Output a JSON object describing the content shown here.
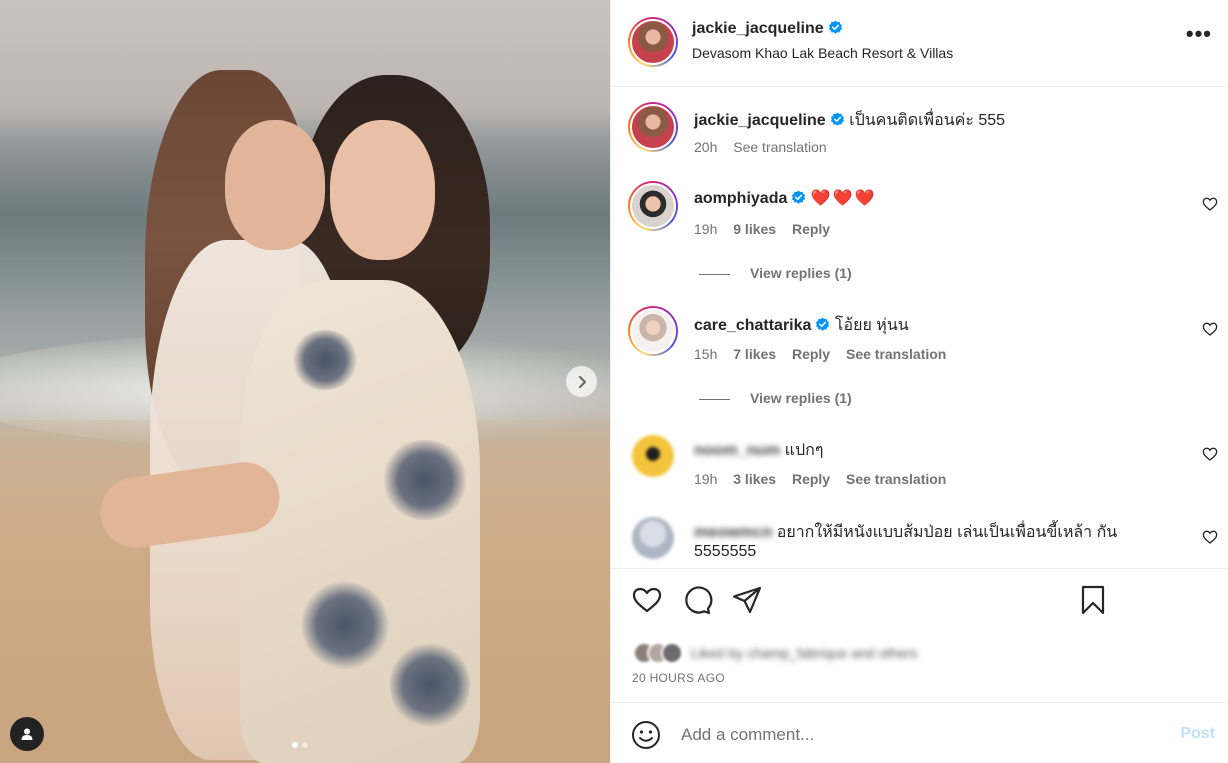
{
  "post": {
    "author": "jackie_jacqueline",
    "location": "Devasom Khao Lak Beach Resort & Villas",
    "more_label": "•••",
    "carousel": {
      "total_slides": 2,
      "active_slide": 1
    }
  },
  "caption": {
    "username": "jackie_jacqueline",
    "text": "เป็นคนติดเพื่อนค่ะ 555",
    "time": "20h",
    "translate": "See translation"
  },
  "comments": [
    {
      "username": "aomphiyada",
      "verified": true,
      "text": "❤️❤️❤️",
      "time": "19h",
      "likes": "9 likes",
      "reply": "Reply",
      "view_replies": "View replies (1)"
    },
    {
      "username": "care_chattarika",
      "verified": true,
      "text": "โอ้ยย หุ่นน",
      "time": "15h",
      "likes": "7 likes",
      "reply": "Reply",
      "translate": "See translation",
      "view_replies": "View replies (1)"
    },
    {
      "username": "noom_num",
      "verified": false,
      "text": "แปกๆ",
      "time": "19h",
      "likes": "3 likes",
      "reply": "Reply",
      "translate": "See translation"
    },
    {
      "username": "meowmcn",
      "verified": false,
      "text": "อยากให้มีหนังแบบส้มป่อย เล่นเป็นเพื่อนขี้เหล้า กัน",
      "text_cont": "5555555"
    }
  ],
  "liked_by": "Liked by champ_fabrique and others",
  "timestamp": "20 HOURS AGO",
  "comment_box": {
    "placeholder": "Add a comment...",
    "post_label": "Post"
  },
  "colors": {
    "verified": "#0095f6",
    "muted": "#737373",
    "post_disabled": "#c0dffd"
  },
  "icons": [
    "heart-icon",
    "comment-icon",
    "share-icon",
    "bookmark-icon",
    "emoji-icon",
    "chevron-right-icon",
    "user-tag-icon",
    "verified-badge-icon"
  ]
}
